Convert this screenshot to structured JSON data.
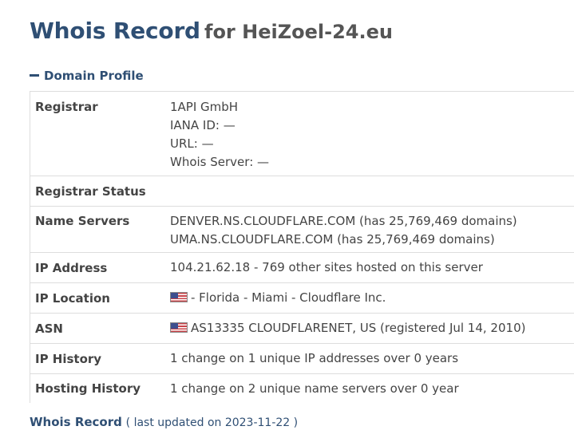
{
  "header": {
    "title": "Whois Record",
    "for_text": "for HeiZoel-24.eu"
  },
  "section": {
    "label": "Domain Profile",
    "toggle_icon": "minus-icon"
  },
  "profile": {
    "registrar": {
      "label": "Registrar",
      "name": "1API GmbH",
      "iana": "IANA ID: —",
      "url": "URL: —",
      "whois_server": "Whois Server: —"
    },
    "registrar_status": {
      "label": "Registrar Status",
      "value": ""
    },
    "name_servers": {
      "label": "Name Servers",
      "servers": [
        "DENVER.NS.CLOUDFLARE.COM (has 25,769,469 domains)",
        "UMA.NS.CLOUDFLARE.COM (has 25,769,469 domains)"
      ]
    },
    "ip_address": {
      "label": "IP Address",
      "value": "104.21.62.18 - 769 other sites hosted on this server"
    },
    "ip_location": {
      "label": "IP Location",
      "value": "- Florida - Miami - Cloudflare Inc.",
      "flag": "us-flag-icon"
    },
    "asn": {
      "label": "ASN",
      "value": "AS13335 CLOUDFLARENET, US (registered Jul 14, 2010)",
      "flag": "us-flag-icon"
    },
    "ip_history": {
      "label": "IP History",
      "value": "1 change on 1 unique IP addresses over 0 years"
    },
    "hosting_history": {
      "label": "Hosting History",
      "value": "1 change on 2 unique name servers over 0 year"
    }
  },
  "footer": {
    "link": "Whois Record",
    "note": "( last updated on 2023-11-22 )"
  },
  "colors": {
    "accent": "#2f4f74",
    "text": "#444444",
    "border": "#dddddd"
  }
}
